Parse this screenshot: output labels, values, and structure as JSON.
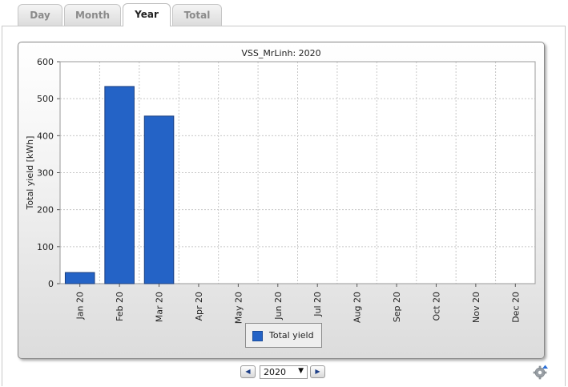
{
  "tabs": [
    {
      "label": "Day",
      "active": false
    },
    {
      "label": "Month",
      "active": false
    },
    {
      "label": "Year",
      "active": true
    },
    {
      "label": "Total",
      "active": false
    }
  ],
  "chart_data": {
    "type": "bar",
    "title": "VSS_MrLinh: 2020",
    "xlabel": "",
    "ylabel": "Total yield [kWh]",
    "ylim": [
      0,
      600
    ],
    "yticks": [
      0,
      100,
      200,
      300,
      400,
      500,
      600
    ],
    "grid": true,
    "categories": [
      "Jan 20",
      "Feb 20",
      "Mar 20",
      "Apr 20",
      "May 20",
      "Jun 20",
      "Jul 20",
      "Aug 20",
      "Sep 20",
      "Oct 20",
      "Nov 20",
      "Dec 20"
    ],
    "series": [
      {
        "name": "Total yield",
        "color": "#2463c6",
        "values": [
          30,
          533,
          453,
          0,
          0,
          0,
          0,
          0,
          0,
          0,
          0,
          0
        ]
      }
    ],
    "legend_position": "bottom"
  },
  "navigation": {
    "prev_icon": "triangle-left-icon",
    "next_icon": "triangle-right-icon",
    "year_value": "2020"
  },
  "settings_icon": "gear-icon"
}
